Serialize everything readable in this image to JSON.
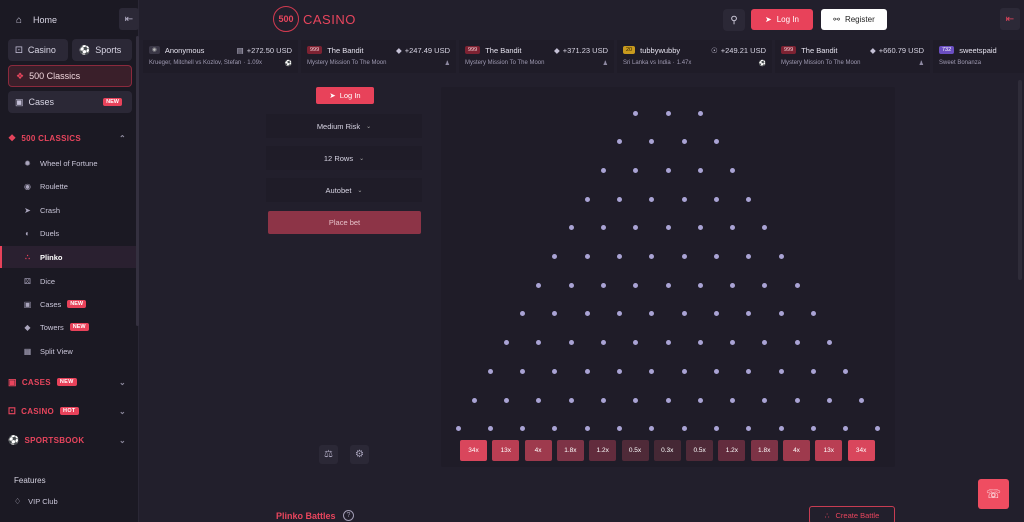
{
  "sidebar": {
    "home": "Home",
    "casino_pill": "Casino",
    "sports_pill": "Sports",
    "classics_pill": "500 Classics",
    "cases_pill": "Cases",
    "new_badge": "NEW",
    "hot_badge": "HOT",
    "classics_header": "500 CLASSICS",
    "items": [
      {
        "label": "Wheel of Fortune"
      },
      {
        "label": "Roulette"
      },
      {
        "label": "Crash"
      },
      {
        "label": "Duels"
      },
      {
        "label": "Plinko"
      },
      {
        "label": "Dice"
      },
      {
        "label": "Cases"
      },
      {
        "label": "Towers"
      },
      {
        "label": "Split View"
      }
    ],
    "cases_header": "CASES",
    "casino_header": "CASINO",
    "sportsbook_header": "SPORTSBOOK",
    "features": "Features",
    "vip": "VIP Club"
  },
  "header": {
    "logo_num": "500",
    "logo_text": "CASINO",
    "login": "Log In",
    "register": "Register"
  },
  "ticker": [
    {
      "tag": "",
      "user": "Anonymous",
      "amount": "+272.50 USD",
      "game": "Krueger, Mitchell vs Kozlov, Stefan",
      "mult": "1.09x"
    },
    {
      "tag": "999",
      "user": "The Bandit",
      "amount": "+247.49 USD",
      "game": "Mystery Mission To The Moon",
      "mult": ""
    },
    {
      "tag": "999",
      "user": "The Bandit",
      "amount": "+371.23 USD",
      "game": "Mystery Mission To The Moon",
      "mult": ""
    },
    {
      "tag": "20",
      "user": "tubbywubby",
      "amount": "+249.21 USD",
      "game": "Sri Lanka vs India",
      "mult": "1.47x"
    },
    {
      "tag": "999",
      "user": "The Bandit",
      "amount": "+660.79 USD",
      "game": "Mystery Mission To The Moon",
      "mult": ""
    },
    {
      "tag": "732",
      "user": "sweetspaid",
      "amount": "",
      "game": "Sweet Bonanza",
      "mult": ""
    }
  ],
  "controls": {
    "login": "Log In",
    "risk": "Medium Risk",
    "rows": "12 Rows",
    "autobet": "Autobet",
    "place_bet": "Place bet"
  },
  "multipliers": [
    "34x",
    "13x",
    "4x",
    "1.8x",
    "1.2x",
    "0.5x",
    "0.3x",
    "0.5x",
    "1.2x",
    "1.8x",
    "4x",
    "13x",
    "34x"
  ],
  "multiplier_colors": [
    "#d9465c",
    "#b93e53",
    "#9e3a4d",
    "#7d3346",
    "#622c3d",
    "#4f2a38",
    "#452835",
    "#4f2a38",
    "#622c3d",
    "#7d3346",
    "#9e3a4d",
    "#b93e53",
    "#d9465c"
  ],
  "board": {
    "rows": 12,
    "peg_color": "#a9a3d4"
  },
  "battles": {
    "title": "Plinko Battles",
    "create": "Create Battle"
  }
}
